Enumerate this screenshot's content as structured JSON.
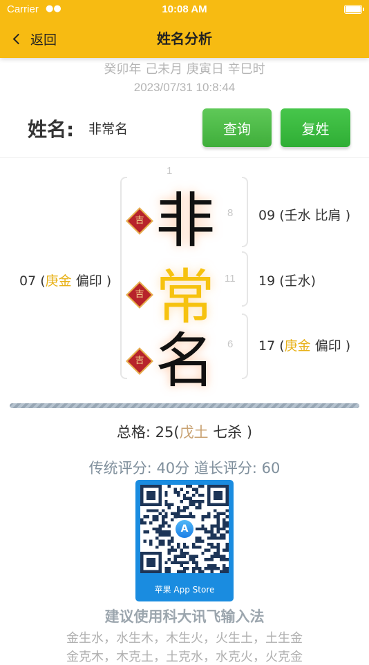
{
  "status": {
    "carrier": "Carrier",
    "time": "10:08 AM"
  },
  "nav": {
    "back_label": "返回",
    "title": "姓名分析"
  },
  "date": {
    "ganzhi": "癸卯年 己未月 庚寅日 辛巳时",
    "datetime": "2023/07/31 10:8:44"
  },
  "form": {
    "label": "姓名:",
    "name_value": "非常名",
    "query_label": "查询",
    "compound_label": "复姓"
  },
  "grid": {
    "top_num": "1",
    "lucky_label": "吉",
    "chars": [
      {
        "char": "非",
        "stroke": "8"
      },
      {
        "char": "常",
        "stroke": "11"
      },
      {
        "char": "名",
        "stroke": "6"
      }
    ],
    "left_note": {
      "num": "07 (",
      "element": "庚金",
      "rest": " 偏印 )"
    },
    "right_notes": [
      {
        "num": "09 (壬水 比肩 )",
        "element": "",
        "rest": ""
      },
      {
        "num": "19 (壬水)",
        "element": "",
        "rest": ""
      },
      {
        "num": "17 (",
        "element": "庚金",
        "rest": " 偏印 )"
      }
    ]
  },
  "total": {
    "prefix": "总格: 25(",
    "element": "戊土",
    "rest": " 七杀 )"
  },
  "scores": "传统评分: 40分 道长评分: 60",
  "qr": {
    "caption": "苹果 App Store"
  },
  "suggest": "建议使用科大讯飞输入法",
  "cycles": {
    "line1": "金生水，水生木，木生火，火生土，土生金",
    "line2": "金克木，木克土，土克水，水克火，火克金"
  },
  "colors": {
    "nav": "#f7bb12",
    "button": "#3fae3b",
    "element": "#e8b21a",
    "qr": "#1a8ce0"
  }
}
